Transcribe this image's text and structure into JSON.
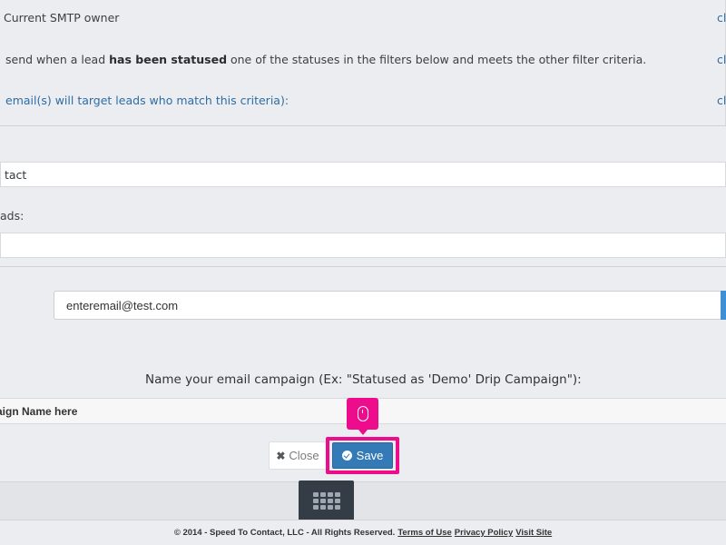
{
  "rules": {
    "owner_text": "Current SMTP owner",
    "send_text_pre": "send when a lead ",
    "send_text_bold": "has been statused",
    "send_text_post": " one of the statuses in the filters below and meets the other filter criteria.",
    "target_link": "email(s) will target leads who match this criteria):",
    "right_links": [
      "cl",
      "cl",
      "cl"
    ]
  },
  "form": {
    "contact_value": "tact",
    "leads_label": "ads:",
    "leads_value": "",
    "email_value": "enteremail@test.com",
    "campaign_label": "Name your email campaign (Ex: \"Statused as 'Demo' Drip Campaign\"):",
    "campaign_placeholder": "aign Name here"
  },
  "buttons": {
    "close_label": "Close",
    "save_label": "Save"
  },
  "highlight_color": "#ec0c8c",
  "footer": {
    "copyright": "© 2014 - Speed To Contact, LLC - All Rights Reserved.",
    "terms": "Terms of Use",
    "privacy": "Privacy Policy",
    "visit": "Visit Site"
  }
}
